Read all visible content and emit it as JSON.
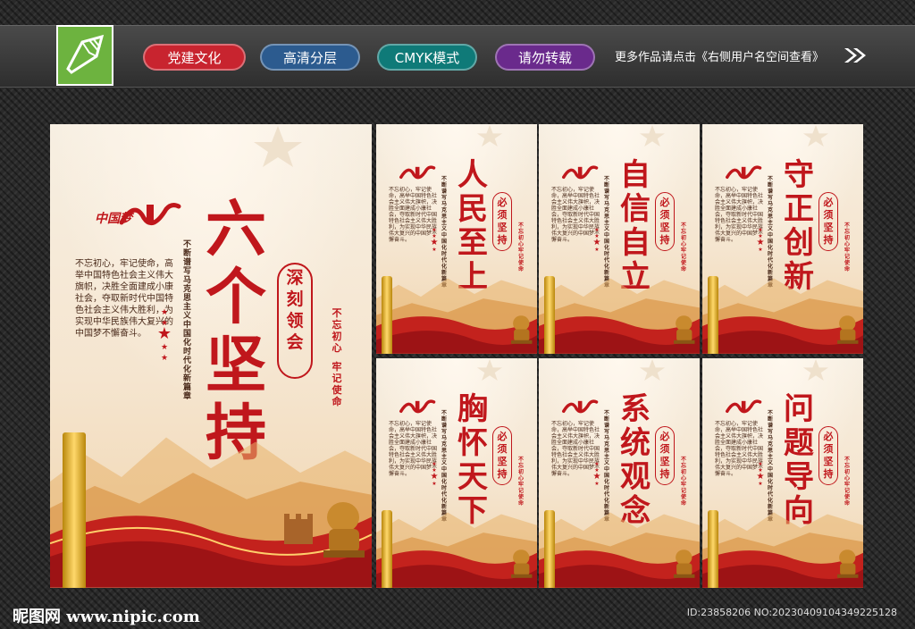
{
  "topbar": {
    "tags": [
      "党建文化",
      "高清分层",
      "CMYK模式",
      "请勿转载"
    ],
    "more_text": "更多作品请点击《右侧用户名空间查看》",
    "logo_icon": "pen-nib-icon",
    "arrow_icon": "double-chevron-right-icon",
    "tag_colors": [
      "#c8242f",
      "#2c5b8f",
      "#0f7a78",
      "#6a2a8c"
    ]
  },
  "main_poster": {
    "dream_logo": "中国梦",
    "title_chars": [
      "六",
      "个",
      "坚",
      "持"
    ],
    "deep_chars": [
      "深",
      "刻",
      "领",
      "会"
    ],
    "slogan_left": [
      "不",
      "忘",
      "初",
      "心"
    ],
    "slogan_right": [
      "牢",
      "记",
      "使",
      "命"
    ],
    "heading": "不断谱写马克思主义中国化时代化新篇章",
    "body": "不忘初心，牢记使命，高举中国特色社会主义伟大旗帜，决胜全面建成小康社会，夺取新时代中国特色社会主义伟大胜利，为实现中华民族伟大复兴的中国梦不懈奋斗。",
    "accent_color": "#c0171c"
  },
  "sub_posters": [
    {
      "title_chars": [
        "人",
        "民",
        "至",
        "上"
      ]
    },
    {
      "title_chars": [
        "自",
        "信",
        "自",
        "立"
      ]
    },
    {
      "title_chars": [
        "守",
        "正",
        "创",
        "新"
      ]
    },
    {
      "title_chars": [
        "胸",
        "怀",
        "天",
        "下"
      ]
    },
    {
      "title_chars": [
        "系",
        "统",
        "观",
        "念"
      ]
    },
    {
      "title_chars": [
        "问",
        "题",
        "导",
        "向"
      ]
    }
  ],
  "sub_common": {
    "must_chars": [
      "必",
      "须",
      "坚",
      "持"
    ],
    "slogan": "不忘初心 牢记使命"
  },
  "footer": {
    "brand": "昵图网 www.nipic.com",
    "id": "ID:23858206 NO:20230409104349225128"
  }
}
